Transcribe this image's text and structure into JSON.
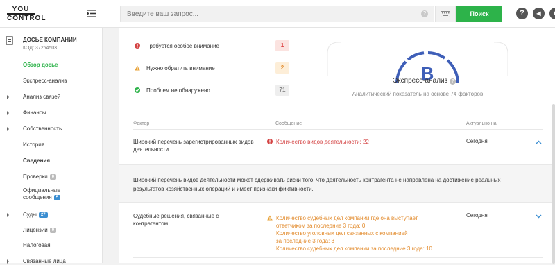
{
  "logo": {
    "line1": "YOU",
    "line2": "CONTROL"
  },
  "search": {
    "placeholder": "Введите ваш запрос...",
    "button": "Поиск",
    "help": "?"
  },
  "header_icons": [
    {
      "name": "help-icon",
      "glyph": "?"
    },
    {
      "name": "telegram-icon",
      "glyph": "◀"
    },
    {
      "name": "user-icon",
      "glyph": "●"
    }
  ],
  "sidebar": {
    "title": "ДОСЬЕ КОМПАНИИ",
    "code": "КОД: 37264503",
    "items": [
      {
        "label": "Обзор досье",
        "active": true,
        "arrow": false
      },
      {
        "label": "Экспресс-анализ",
        "arrow": false
      },
      {
        "label": "Анализ связей",
        "arrow": true
      },
      {
        "label": "Финансы",
        "arrow": true
      },
      {
        "label": "Собственность",
        "arrow": true
      },
      {
        "label": "История",
        "arrow": false
      },
      {
        "label": "Сведения",
        "arrow": false,
        "bold": true
      },
      {
        "label": "Проверки",
        "arrow": false,
        "badge": "0"
      },
      {
        "label": "Официальные",
        "label2": "сообщения",
        "arrow": false,
        "badge": "5",
        "badge_blue": true
      },
      {
        "label": "Суды",
        "arrow": true,
        "badge": "27",
        "badge_blue": true
      },
      {
        "label": "Лицензии",
        "arrow": false,
        "badge": "0"
      },
      {
        "label": "Налоговая",
        "arrow": false
      },
      {
        "label": "Связанные лица",
        "arrow": true
      }
    ]
  },
  "stats": [
    {
      "label": "Требуется особое внимание",
      "count": "1",
      "level": "red"
    },
    {
      "label": "Нужно обратить внимание",
      "count": "2",
      "level": "orange"
    },
    {
      "label": "Проблем не обнаружено",
      "count": "71",
      "level": "gray"
    }
  ],
  "gauge": {
    "grade": "B",
    "title": "Экспресс-анализ",
    "subtitle": "Аналитический показатель на основе 74 факторов",
    "color": "#3f5fb8"
  },
  "table": {
    "headers": {
      "factor": "Фактор",
      "message": "Сообщение",
      "actual": "Актуально на"
    },
    "rows": [
      {
        "factor": "Широкий перечень зарегистрированных видов деятельности",
        "messages": [
          "Количество видов деятельности: 22"
        ],
        "level": "red",
        "actual": "Сегодня",
        "expanded": true
      },
      {
        "factor": "Судебные решения, связанные с контрагентом",
        "messages": [
          "Количество судебных дел компании где она выступает",
          "ответчиком за последние 3 года: 0",
          "Количество уголовных дел связанных с компанией",
          "за последние 3 года: 3",
          "Количество судебных дел компании за последние 3 года: 10"
        ],
        "level": "orange",
        "actual": "Сегодня",
        "expanded": false
      }
    ],
    "explanation": "Широкий перечень видов деятельности может сдерживать риски того, что деятельность контрагента не направлена на достижение реальных результатов хозяйственных операций и имеет признаки фиктивности."
  },
  "colors": {
    "accent": "#2db34a",
    "red": "#d44444",
    "orange": "#e28a2b",
    "blue": "#3b8ed1"
  }
}
